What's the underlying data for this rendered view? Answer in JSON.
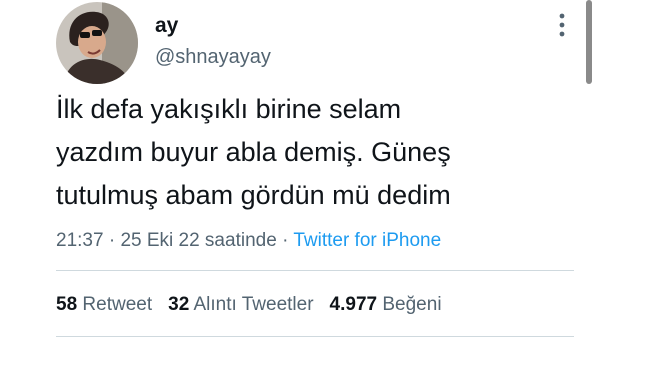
{
  "author": {
    "display_name": "ay",
    "handle": "@shnayayay",
    "avatar_icon": "profile-photo"
  },
  "tweet": {
    "text": "İlk defa yakışıklı birine selam\nyazdım buyur abla demiş. Güneş\ntutulmuş abam gördün mü dedim",
    "time": "21:37",
    "date": "25 Eki 22 saatinde",
    "separator": "·",
    "source": "Twitter for iPhone"
  },
  "stats": {
    "retweets_count": "58",
    "retweets_label": "Retweet",
    "quotes_count": "32",
    "quotes_label": "Alıntı Tweetler",
    "likes_count": "4.977",
    "likes_label": "Beğeni"
  },
  "colors": {
    "text": "#0f1419",
    "secondary": "#536471",
    "link": "#1d9bf0",
    "divider": "#cfd9de"
  }
}
